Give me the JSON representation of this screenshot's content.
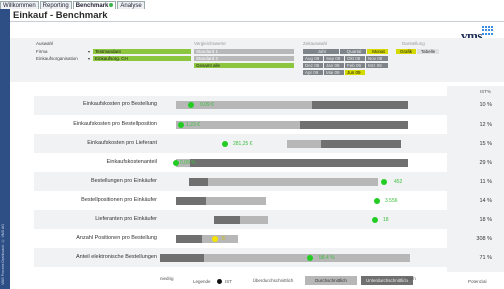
{
  "tabs": [
    {
      "label": "Willkommen",
      "active": false
    },
    {
      "label": "Reporting",
      "active": false
    },
    {
      "label": "Benchmark",
      "active": true
    },
    {
      "label": "Analyse",
      "active": false
    }
  ],
  "title": "Einkauf - Benchmark",
  "logo_text": "vms",
  "sidebar_text": "VMS Process Dashboard - © VMS AG",
  "filters": {
    "auswahl_label": "Auswahl",
    "firma_label": "Firma",
    "firma_value": "Testmandant",
    "eo_label": "Einkaufsorganisation",
    "eo_value": "Einkaufsorg. CH",
    "vergleich_label": "Vergleichswerte",
    "vergleich_values": [
      "Standard 1",
      "Standard 2",
      "Gesamt alle"
    ],
    "zeit_label": "Zeitauswahl",
    "zeit_header": [
      "Jahr",
      "Quartal",
      "Monat"
    ],
    "zeit_rows": [
      [
        "Aug 08",
        "Sep 08",
        "Okt 08",
        "Nov 08"
      ],
      [
        "Dez 08",
        "Jan 09",
        "Feb 09",
        "Mrz 09"
      ],
      [
        "Apr 09",
        "Mai 09",
        "Jun 09",
        ""
      ]
    ],
    "darst_label": "Darstellung",
    "darst_options": [
      "Grafik",
      "Tabelle"
    ]
  },
  "pct_header": "IST%",
  "rows": [
    {
      "label": "Einkaufskosten pro Bestellung",
      "value": "9,09 €",
      "pct": "10 %",
      "dot": "green"
    },
    {
      "label": "Einkaufskosten pro Bestellposition",
      "value": "1,23 €",
      "pct": "12 %",
      "dot": "green"
    },
    {
      "label": "Einkaufskosten pro Lieferant",
      "value": "281,25 €",
      "pct": "15 %",
      "dot": "green"
    },
    {
      "label": "Einkaufskostenanteil",
      "value": "0,09 %",
      "pct": "29 %",
      "dot": "green"
    },
    {
      "label": "Bestellungen pro Einkäufer",
      "value": "452",
      "pct": "11 %",
      "dot": "green"
    },
    {
      "label": "Bestellpositionen pro Einkäufer",
      "value": "3.556",
      "pct": "14 %",
      "dot": "green"
    },
    {
      "label": "Lieferanten pro Einkäufer",
      "value": "18",
      "pct": "18 %",
      "dot": "green"
    },
    {
      "label": "Anzahl Positionen pro Bestellung",
      "value": "8",
      "pct": "308 %",
      "dot": "yellow"
    },
    {
      "label": "Anteil elektronische Bestellungen",
      "value": "58,4 %",
      "pct": "71 %",
      "dot": "green"
    }
  ],
  "legend": {
    "niedrig": "niedrig",
    "hoch": "hoch",
    "legende": "Legende",
    "ist": "IST",
    "ueber": "Überdurchschnittlich",
    "durch": "Durchschnittlich",
    "unter": "Unterdurchschnittlich",
    "potenzial": "Potenzial"
  }
}
